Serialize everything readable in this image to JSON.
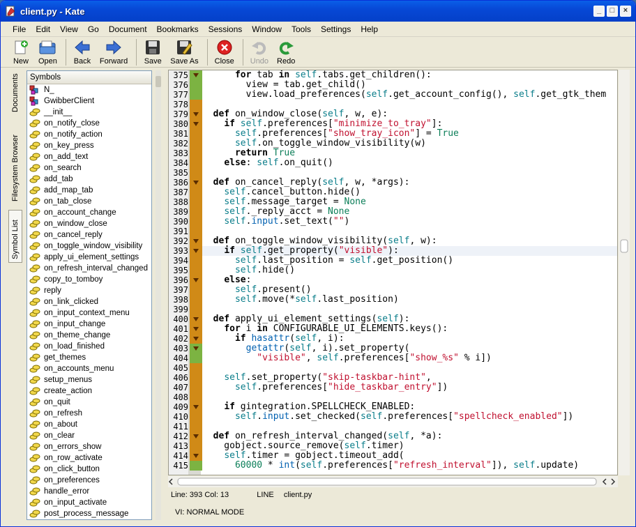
{
  "window": {
    "title": "client.py - Kate",
    "controls": [
      "_",
      "□",
      "×"
    ]
  },
  "menu": [
    {
      "label": "File"
    },
    {
      "label": "Edit"
    },
    {
      "label": "View"
    },
    {
      "label": "Go"
    },
    {
      "label": "Document"
    },
    {
      "label": "Bookmarks"
    },
    {
      "label": "Sessions"
    },
    {
      "label": "Window"
    },
    {
      "label": "Tools"
    },
    {
      "label": "Settings"
    },
    {
      "label": "Help"
    }
  ],
  "toolbar": {
    "new": "New",
    "open": "Open",
    "back": "Back",
    "forward": "Forward",
    "save": "Save",
    "save_as": "Save As",
    "close": "Close",
    "undo": "Undo",
    "redo": "Redo"
  },
  "side_tabs": {
    "documents": "Documents",
    "filesystem": "Filesystem Browser",
    "symbol_list": "Symbol List"
  },
  "symbols": {
    "header": "Symbols",
    "items": [
      {
        "label": "N_",
        "kind": "class"
      },
      {
        "label": "GwibberClient",
        "kind": "class"
      },
      {
        "label": "__init__",
        "kind": "method"
      },
      {
        "label": "on_notify_close",
        "kind": "method"
      },
      {
        "label": "on_notify_action",
        "kind": "method"
      },
      {
        "label": "on_key_press",
        "kind": "method"
      },
      {
        "label": "on_add_text",
        "kind": "method"
      },
      {
        "label": "on_search",
        "kind": "method"
      },
      {
        "label": "add_tab",
        "kind": "method"
      },
      {
        "label": "add_map_tab",
        "kind": "method"
      },
      {
        "label": "on_tab_close",
        "kind": "method"
      },
      {
        "label": "on_account_change",
        "kind": "method"
      },
      {
        "label": "on_window_close",
        "kind": "method"
      },
      {
        "label": "on_cancel_reply",
        "kind": "method"
      },
      {
        "label": "on_toggle_window_visibility",
        "kind": "method"
      },
      {
        "label": "apply_ui_element_settings",
        "kind": "method"
      },
      {
        "label": "on_refresh_interval_changed",
        "kind": "method"
      },
      {
        "label": "copy_to_tomboy",
        "kind": "method"
      },
      {
        "label": "reply",
        "kind": "method"
      },
      {
        "label": "on_link_clicked",
        "kind": "method"
      },
      {
        "label": "on_input_context_menu",
        "kind": "method"
      },
      {
        "label": "on_input_change",
        "kind": "method"
      },
      {
        "label": "on_theme_change",
        "kind": "method"
      },
      {
        "label": "on_load_finished",
        "kind": "method"
      },
      {
        "label": "get_themes",
        "kind": "method"
      },
      {
        "label": "on_accounts_menu",
        "kind": "method"
      },
      {
        "label": "setup_menus",
        "kind": "method"
      },
      {
        "label": "create_action",
        "kind": "method"
      },
      {
        "label": "on_quit",
        "kind": "method"
      },
      {
        "label": "on_refresh",
        "kind": "method"
      },
      {
        "label": "on_about",
        "kind": "method"
      },
      {
        "label": "on_clear",
        "kind": "method"
      },
      {
        "label": "on_errors_show",
        "kind": "method"
      },
      {
        "label": "on_row_activate",
        "kind": "method"
      },
      {
        "label": "on_click_button",
        "kind": "method"
      },
      {
        "label": "on_preferences",
        "kind": "method"
      },
      {
        "label": "handle_error",
        "kind": "method"
      },
      {
        "label": "on_input_activate",
        "kind": "method"
      },
      {
        "label": "post_process_message",
        "kind": "method"
      }
    ]
  },
  "editor": {
    "current_line": 393,
    "lines": [
      {
        "n": "375",
        "fold": "v",
        "mark": "green",
        "segs": [
          [
            "      ",
            ""
          ],
          [
            "for",
            "kw"
          ],
          [
            " tab ",
            ""
          ],
          [
            "in",
            "kw"
          ],
          [
            " ",
            ""
          ],
          [
            "self",
            "sf"
          ],
          [
            ".tabs.get_children():",
            ""
          ]
        ]
      },
      {
        "n": "376",
        "fold": "",
        "mark": "green",
        "segs": [
          [
            "        view = tab.get_child()",
            ""
          ]
        ]
      },
      {
        "n": "377",
        "fold": "",
        "mark": "green",
        "segs": [
          [
            "        view.load_preferences(",
            ""
          ],
          [
            "self",
            "sf"
          ],
          [
            ".get_account_config(), ",
            ""
          ],
          [
            "self",
            "sf"
          ],
          [
            ".get_gtk_them",
            ""
          ]
        ]
      },
      {
        "n": "378",
        "fold": "",
        "mark": "orange",
        "segs": [
          [
            "",
            ""
          ]
        ]
      },
      {
        "n": "379",
        "fold": "v",
        "mark": "orange",
        "segs": [
          [
            "  ",
            ""
          ],
          [
            "def",
            "kw"
          ],
          [
            " on_window_close(",
            ""
          ],
          [
            "self",
            "sf"
          ],
          [
            ", w, e):",
            ""
          ]
        ]
      },
      {
        "n": "380",
        "fold": "v",
        "mark": "orange",
        "segs": [
          [
            "    ",
            ""
          ],
          [
            "if",
            "kw"
          ],
          [
            " ",
            ""
          ],
          [
            "self",
            "sf"
          ],
          [
            ".preferences[",
            ""
          ],
          [
            "\"minimize_to_tray\"",
            "st"
          ],
          [
            "]:",
            ""
          ]
        ]
      },
      {
        "n": "381",
        "fold": "",
        "mark": "orange",
        "segs": [
          [
            "      ",
            ""
          ],
          [
            "self",
            "sf"
          ],
          [
            ".preferences[",
            ""
          ],
          [
            "\"show_tray_icon\"",
            "st"
          ],
          [
            "] = ",
            ""
          ],
          [
            "True",
            "nm"
          ]
        ]
      },
      {
        "n": "382",
        "fold": "",
        "mark": "orange",
        "segs": [
          [
            "      ",
            ""
          ],
          [
            "self",
            "sf"
          ],
          [
            ".on_toggle_window_visibility(w)",
            ""
          ]
        ]
      },
      {
        "n": "383",
        "fold": "",
        "mark": "orange",
        "segs": [
          [
            "      ",
            ""
          ],
          [
            "return",
            "kw"
          ],
          [
            " ",
            ""
          ],
          [
            "True",
            "nm"
          ]
        ]
      },
      {
        "n": "384",
        "fold": "",
        "mark": "orange",
        "segs": [
          [
            "    ",
            ""
          ],
          [
            "else",
            "kw"
          ],
          [
            ": ",
            ""
          ],
          [
            "self",
            "sf"
          ],
          [
            ".on_quit()",
            ""
          ]
        ]
      },
      {
        "n": "385",
        "fold": "",
        "mark": "orange",
        "segs": [
          [
            "",
            ""
          ]
        ]
      },
      {
        "n": "386",
        "fold": "v",
        "mark": "orange",
        "segs": [
          [
            "  ",
            ""
          ],
          [
            "def",
            "kw"
          ],
          [
            " on_cancel_reply(",
            ""
          ],
          [
            "self",
            "sf"
          ],
          [
            ", w, *args):",
            ""
          ]
        ]
      },
      {
        "n": "387",
        "fold": "",
        "mark": "orange",
        "segs": [
          [
            "    ",
            ""
          ],
          [
            "self",
            "sf"
          ],
          [
            ".cancel_button.hide()",
            ""
          ]
        ]
      },
      {
        "n": "388",
        "fold": "",
        "mark": "orange",
        "segs": [
          [
            "    ",
            ""
          ],
          [
            "self",
            "sf"
          ],
          [
            ".message_target = ",
            ""
          ],
          [
            "None",
            "nm"
          ]
        ]
      },
      {
        "n": "389",
        "fold": "",
        "mark": "orange",
        "segs": [
          [
            "    ",
            ""
          ],
          [
            "self",
            "sf"
          ],
          [
            "._reply_acct = ",
            ""
          ],
          [
            "None",
            "nm"
          ]
        ]
      },
      {
        "n": "390",
        "fold": "",
        "mark": "orange",
        "segs": [
          [
            "    ",
            ""
          ],
          [
            "self",
            "sf"
          ],
          [
            ".",
            ""
          ],
          [
            "input",
            "bi"
          ],
          [
            ".set_text(",
            ""
          ],
          [
            "\"\"",
            "st"
          ],
          [
            ")",
            ""
          ]
        ]
      },
      {
        "n": "391",
        "fold": "",
        "mark": "orange",
        "segs": [
          [
            "",
            ""
          ]
        ]
      },
      {
        "n": "392",
        "fold": "v",
        "mark": "orange",
        "segs": [
          [
            "  ",
            ""
          ],
          [
            "def",
            "kw"
          ],
          [
            " on_toggle_window_visibility(",
            ""
          ],
          [
            "self",
            "sf"
          ],
          [
            ", w):",
            ""
          ]
        ]
      },
      {
        "n": "393",
        "fold": "v",
        "mark": "orange",
        "segs": [
          [
            "    ",
            ""
          ],
          [
            "if",
            "kw"
          ],
          [
            " ",
            ""
          ],
          [
            "self",
            "sf"
          ],
          [
            ".get_property(",
            ""
          ],
          [
            "\"visible\"",
            "st"
          ],
          [
            "):",
            ""
          ]
        ]
      },
      {
        "n": "394",
        "fold": "",
        "mark": "orange",
        "segs": [
          [
            "      ",
            ""
          ],
          [
            "self",
            "sf"
          ],
          [
            ".last_position = ",
            ""
          ],
          [
            "self",
            "sf"
          ],
          [
            ".get_position()",
            ""
          ]
        ]
      },
      {
        "n": "395",
        "fold": "",
        "mark": "orange",
        "segs": [
          [
            "      ",
            ""
          ],
          [
            "self",
            "sf"
          ],
          [
            ".hide()",
            ""
          ]
        ]
      },
      {
        "n": "396",
        "fold": "v",
        "mark": "orange",
        "segs": [
          [
            "    ",
            ""
          ],
          [
            "else",
            "kw"
          ],
          [
            ":",
            ""
          ]
        ]
      },
      {
        "n": "397",
        "fold": "",
        "mark": "orange",
        "segs": [
          [
            "      ",
            ""
          ],
          [
            "self",
            "sf"
          ],
          [
            ".present()",
            ""
          ]
        ]
      },
      {
        "n": "398",
        "fold": "",
        "mark": "orange",
        "segs": [
          [
            "      ",
            ""
          ],
          [
            "self",
            "sf"
          ],
          [
            ".move(*",
            ""
          ],
          [
            "self",
            "sf"
          ],
          [
            ".last_position)",
            ""
          ]
        ]
      },
      {
        "n": "399",
        "fold": "",
        "mark": "orange",
        "segs": [
          [
            "",
            ""
          ]
        ]
      },
      {
        "n": "400",
        "fold": "v",
        "mark": "orange",
        "segs": [
          [
            "  ",
            ""
          ],
          [
            "def",
            "kw"
          ],
          [
            " apply_ui_element_settings(",
            ""
          ],
          [
            "self",
            "sf"
          ],
          [
            "):",
            ""
          ]
        ]
      },
      {
        "n": "401",
        "fold": "v",
        "mark": "orange",
        "segs": [
          [
            "    ",
            ""
          ],
          [
            "for",
            "kw"
          ],
          [
            " i ",
            ""
          ],
          [
            "in",
            "kw"
          ],
          [
            " CONFIGURABLE_UI_ELEMENTS.keys():",
            ""
          ]
        ]
      },
      {
        "n": "402",
        "fold": "v",
        "mark": "orange",
        "segs": [
          [
            "      ",
            ""
          ],
          [
            "if",
            "kw"
          ],
          [
            " ",
            ""
          ],
          [
            "hasattr",
            "bi"
          ],
          [
            "(",
            ""
          ],
          [
            "self",
            "sf"
          ],
          [
            ", i):",
            ""
          ]
        ]
      },
      {
        "n": "403",
        "fold": "v",
        "mark": "green",
        "segs": [
          [
            "        ",
            ""
          ],
          [
            "getattr",
            "bi"
          ],
          [
            "(",
            ""
          ],
          [
            "self",
            "sf"
          ],
          [
            ", i).set_property(",
            ""
          ]
        ]
      },
      {
        "n": "404",
        "fold": "",
        "mark": "green",
        "segs": [
          [
            "          ",
            ""
          ],
          [
            "\"visible\"",
            "st"
          ],
          [
            ", ",
            ""
          ],
          [
            "self",
            "sf"
          ],
          [
            ".preferences[",
            ""
          ],
          [
            "\"show_%s\"",
            "st"
          ],
          [
            " % i])",
            ""
          ]
        ]
      },
      {
        "n": "405",
        "fold": "",
        "mark": "orange",
        "segs": [
          [
            "",
            ""
          ]
        ]
      },
      {
        "n": "406",
        "fold": "",
        "mark": "orange",
        "segs": [
          [
            "    ",
            ""
          ],
          [
            "self",
            "sf"
          ],
          [
            ".set_property(",
            ""
          ],
          [
            "\"skip-taskbar-hint\"",
            "st"
          ],
          [
            ",",
            ""
          ]
        ]
      },
      {
        "n": "407",
        "fold": "",
        "mark": "orange",
        "segs": [
          [
            "      ",
            ""
          ],
          [
            "self",
            "sf"
          ],
          [
            ".preferences[",
            ""
          ],
          [
            "\"hide_taskbar_entry\"",
            "st"
          ],
          [
            "])",
            ""
          ]
        ]
      },
      {
        "n": "408",
        "fold": "",
        "mark": "orange",
        "segs": [
          [
            "",
            ""
          ]
        ]
      },
      {
        "n": "409",
        "fold": "v",
        "mark": "orange",
        "segs": [
          [
            "    ",
            ""
          ],
          [
            "if",
            "kw"
          ],
          [
            " gintegration.SPELLCHECK_ENABLED:",
            ""
          ]
        ]
      },
      {
        "n": "410",
        "fold": "",
        "mark": "orange",
        "segs": [
          [
            "      ",
            ""
          ],
          [
            "self",
            "sf"
          ],
          [
            ".",
            ""
          ],
          [
            "input",
            "bi"
          ],
          [
            ".set_checked(",
            ""
          ],
          [
            "self",
            "sf"
          ],
          [
            ".preferences[",
            ""
          ],
          [
            "\"spellcheck_enabled\"",
            "st"
          ],
          [
            "])",
            ""
          ]
        ]
      },
      {
        "n": "411",
        "fold": "",
        "mark": "orange",
        "segs": [
          [
            "",
            ""
          ]
        ]
      },
      {
        "n": "412",
        "fold": "v",
        "mark": "orange",
        "segs": [
          [
            "  ",
            ""
          ],
          [
            "def",
            "kw"
          ],
          [
            " on_refresh_interval_changed(",
            ""
          ],
          [
            "self",
            "sf"
          ],
          [
            ", *a):",
            ""
          ]
        ]
      },
      {
        "n": "413",
        "fold": "",
        "mark": "orange",
        "segs": [
          [
            "    gobject.source_remove(",
            ""
          ],
          [
            "self",
            "sf"
          ],
          [
            ".timer)",
            ""
          ]
        ]
      },
      {
        "n": "414",
        "fold": "v",
        "mark": "orange",
        "segs": [
          [
            "    ",
            ""
          ],
          [
            "self",
            "sf"
          ],
          [
            ".timer = gobject.timeout_add(",
            ""
          ]
        ]
      },
      {
        "n": "415",
        "fold": "",
        "mark": "green",
        "segs": [
          [
            "      ",
            ""
          ],
          [
            "60000",
            "nm"
          ],
          [
            " * ",
            ""
          ],
          [
            "int",
            "bi"
          ],
          [
            "(",
            ""
          ],
          [
            "self",
            "sf"
          ],
          [
            ".preferences[",
            ""
          ],
          [
            "\"refresh_interval\"",
            "st"
          ],
          [
            "]), ",
            ""
          ],
          [
            "self",
            "sf"
          ],
          [
            ".update)",
            ""
          ]
        ]
      }
    ]
  },
  "status": {
    "position": "Line: 393 Col: 13",
    "mode": "LINE",
    "file": "client.py",
    "vi_mode": "VI: NORMAL MODE"
  }
}
